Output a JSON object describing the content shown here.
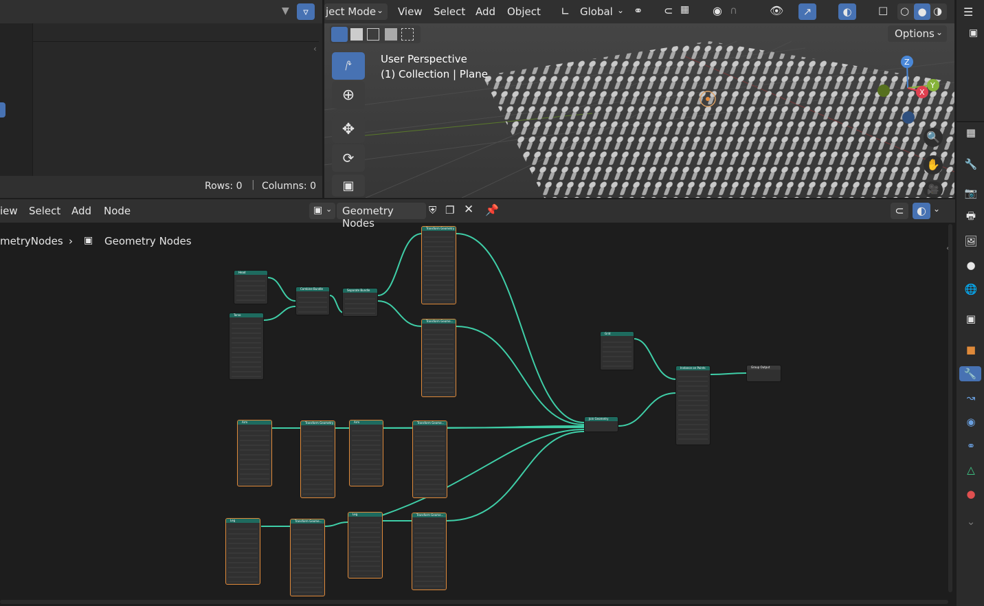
{
  "spreadsheet": {
    "rows_label": "Rows: 0",
    "columns_label": "Columns: 0"
  },
  "viewport": {
    "mode_label": "ject Mode",
    "menu": [
      "View",
      "Select",
      "Add",
      "Object"
    ],
    "orientation_label": "Global",
    "options_label": "Options",
    "overlay_line1": "User Perspective",
    "overlay_line2": "(1) Collection | Plane",
    "gizmo": {
      "x": "X",
      "y": "Y",
      "z": "Z"
    }
  },
  "node_editor": {
    "menu": [
      "iew",
      "Select",
      "Add",
      "Node"
    ],
    "tree_name": "Geometry Nodes",
    "breadcrumb_root": "metryNodes",
    "breadcrumb_leaf": "Geometry Nodes"
  },
  "nodes": [
    {
      "title": "Head"
    },
    {
      "title": "Torso"
    },
    {
      "title": "Combine Bundle"
    },
    {
      "title": "Separate Bundle"
    },
    {
      "title": "Transform Geometry"
    },
    {
      "title": "Transform Geome..."
    },
    {
      "title": "Grid"
    },
    {
      "title": "Instance on Points"
    },
    {
      "title": "Group Output"
    },
    {
      "title": "Join Geometry"
    },
    {
      "title": "Arm"
    },
    {
      "title": "Transform Geometry"
    },
    {
      "title": "Arm"
    },
    {
      "title": "Transform Geome..."
    },
    {
      "title": "Leg"
    },
    {
      "title": "Transform Geome..."
    },
    {
      "title": "Leg"
    },
    {
      "title": "Transform Geome..."
    }
  ],
  "colors": {
    "node_header": "#1e6b5f",
    "link": "#3fcfa8",
    "selected": "#e08a3a",
    "accent": "#4772b3"
  }
}
